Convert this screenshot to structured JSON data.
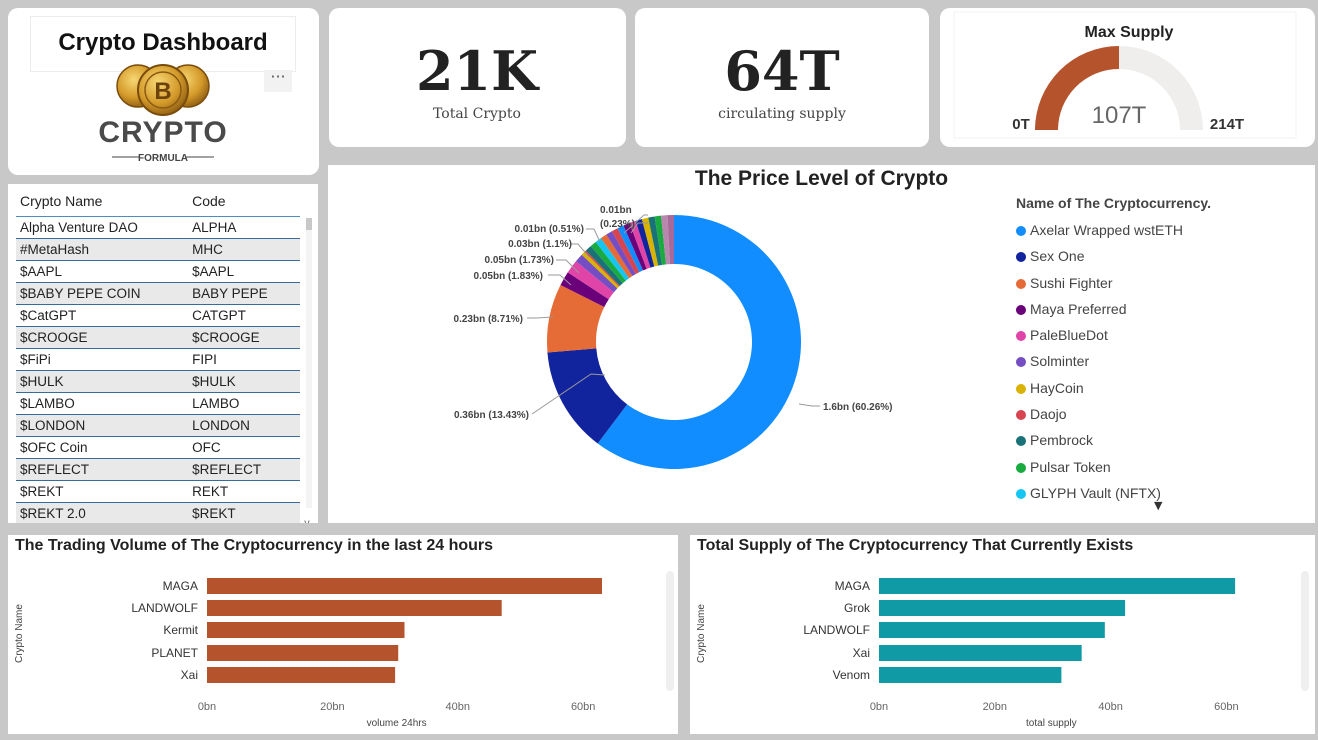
{
  "title": "Crypto Dashboard",
  "logo": {
    "word": "CRYPTO",
    "sub": "FORMULA",
    "coin_letter": "B"
  },
  "more_label": "···",
  "kpis": [
    {
      "value": "21K",
      "label": "Total Crypto"
    },
    {
      "value": "64T",
      "label": "circulating supply"
    }
  ],
  "gauge": {
    "title": "Max Supply",
    "min_label": "0T",
    "max_label": "214T",
    "value_label": "107T",
    "fraction": 0.5,
    "fill_color": "#b5532c",
    "track_color": "#efeeec"
  },
  "table": {
    "headers": [
      "Crypto Name",
      "Code"
    ],
    "rows": [
      [
        "Alpha Venture DAO",
        "ALPHA"
      ],
      [
        "#MetaHash",
        "MHC"
      ],
      [
        "$AAPL",
        "$AAPL"
      ],
      [
        "$BABY PEPE COIN",
        "BABY PEPE"
      ],
      [
        "$CatGPT",
        "CATGPT"
      ],
      [
        "$CROOGE",
        "$CROOGE"
      ],
      [
        "$FiPi",
        "FIPI"
      ],
      [
        "$HULK",
        "$HULK"
      ],
      [
        "$LAMBO",
        "LAMBO"
      ],
      [
        "$LONDON",
        "LONDON"
      ],
      [
        "$OFC Coin",
        "OFC"
      ],
      [
        "$REFLECT",
        "$REFLECT"
      ],
      [
        "$REKT",
        "REKT"
      ],
      [
        "$REKT 2.0",
        "$REKT"
      ]
    ],
    "scroll_down": "v"
  },
  "pie_chart": {
    "title": "The Price Level of Crypto",
    "legend_title": "Name of The Cryptocurrency.",
    "legend": [
      {
        "name": "Axelar Wrapped wstETH",
        "color": "#118dff"
      },
      {
        "name": "Sex One",
        "color": "#12239e"
      },
      {
        "name": "Sushi Fighter",
        "color": "#e66c37"
      },
      {
        "name": "Maya Preferred",
        "color": "#6b007b"
      },
      {
        "name": "PaleBlueDot",
        "color": "#e044a7"
      },
      {
        "name": "Solminter",
        "color": "#744ec2"
      },
      {
        "name": "HayCoin",
        "color": "#d9b300"
      },
      {
        "name": "Daojo",
        "color": "#d64550"
      },
      {
        "name": "Pembrock",
        "color": "#197278"
      },
      {
        "name": "Pulsar Token",
        "color": "#1aab40"
      },
      {
        "name": "GLYPH Vault (NFTX)",
        "color": "#15c6f4"
      }
    ],
    "legend_more": "▼",
    "labels": [
      "1.6bn (60.26%)",
      "0.36bn (13.43%)",
      "0.23bn (8.71%)",
      "0.05bn (1.83%)",
      "0.05bn (1.73%)",
      "0.03bn (1.1%)",
      "0.01bn (0.51%)",
      "0.01bn",
      "(0.23%)"
    ]
  },
  "chart_data": [
    {
      "type": "pie",
      "title": "The Price Level of Crypto",
      "legend_title": "Name of The Cryptocurrency.",
      "slices": [
        {
          "name": "Axelar Wrapped wstETH",
          "value": 1.6,
          "percent": 60.26,
          "color": "#118dff"
        },
        {
          "name": "Sex One",
          "value": 0.36,
          "percent": 13.43,
          "color": "#12239e"
        },
        {
          "name": "Sushi Fighter",
          "value": 0.23,
          "percent": 8.71,
          "color": "#e66c37"
        },
        {
          "name": "Maya Preferred",
          "value": 0.05,
          "percent": 1.83,
          "color": "#6b007b"
        },
        {
          "name": "PaleBlueDot",
          "value": 0.05,
          "percent": 1.73,
          "color": "#e044a7"
        },
        {
          "name": "Solminter",
          "value": 0.03,
          "percent": 1.1,
          "color": "#744ec2"
        },
        {
          "name": "HayCoin",
          "value": 0.01,
          "percent": 0.51,
          "color": "#d9b300"
        },
        {
          "name": "Daojo",
          "value": 0.01,
          "percent": 0.23,
          "color": "#d64550"
        }
      ],
      "other_colors": [
        "#197278",
        "#1aab40",
        "#15c6f4",
        "#e66c37",
        "#744ec2",
        "#d64550",
        "#118dff",
        "#6b007b",
        "#e044a7",
        "#12239e",
        "#d9b300",
        "#197278",
        "#1aab40",
        "#b887ad",
        "#a66999"
      ],
      "legend_placement": "right"
    },
    {
      "type": "bar",
      "orientation": "horizontal",
      "title": "The Trading Volume of The Cryptocurrency in the last 24 hours",
      "categories": [
        "MAGA",
        "LANDWOLF",
        "Kermit",
        "PLANET",
        "Xai"
      ],
      "values": [
        63,
        47,
        31.5,
        30.5,
        30
      ],
      "xlabel": "volume 24hrs",
      "ylabel": "Crypto Name",
      "xlim": [
        0,
        63
      ],
      "xticks": [
        "0bn",
        "20bn",
        "40bn",
        "60bn"
      ],
      "color": "#b5532c"
    },
    {
      "type": "bar",
      "orientation": "horizontal",
      "title": "Total Supply of The Cryptocurrency That Currently Exists",
      "categories": [
        "MAGA",
        "Grok",
        "LANDWOLF",
        "Xai",
        "Venom"
      ],
      "values": [
        61.5,
        42.5,
        39,
        35,
        31.5
      ],
      "xlabel": "total supply",
      "ylabel": "Crypto Name",
      "xlim": [
        0,
        62
      ],
      "xticks": [
        "0bn",
        "20bn",
        "40bn",
        "60bn"
      ],
      "color": "#0f9aa6"
    }
  ]
}
